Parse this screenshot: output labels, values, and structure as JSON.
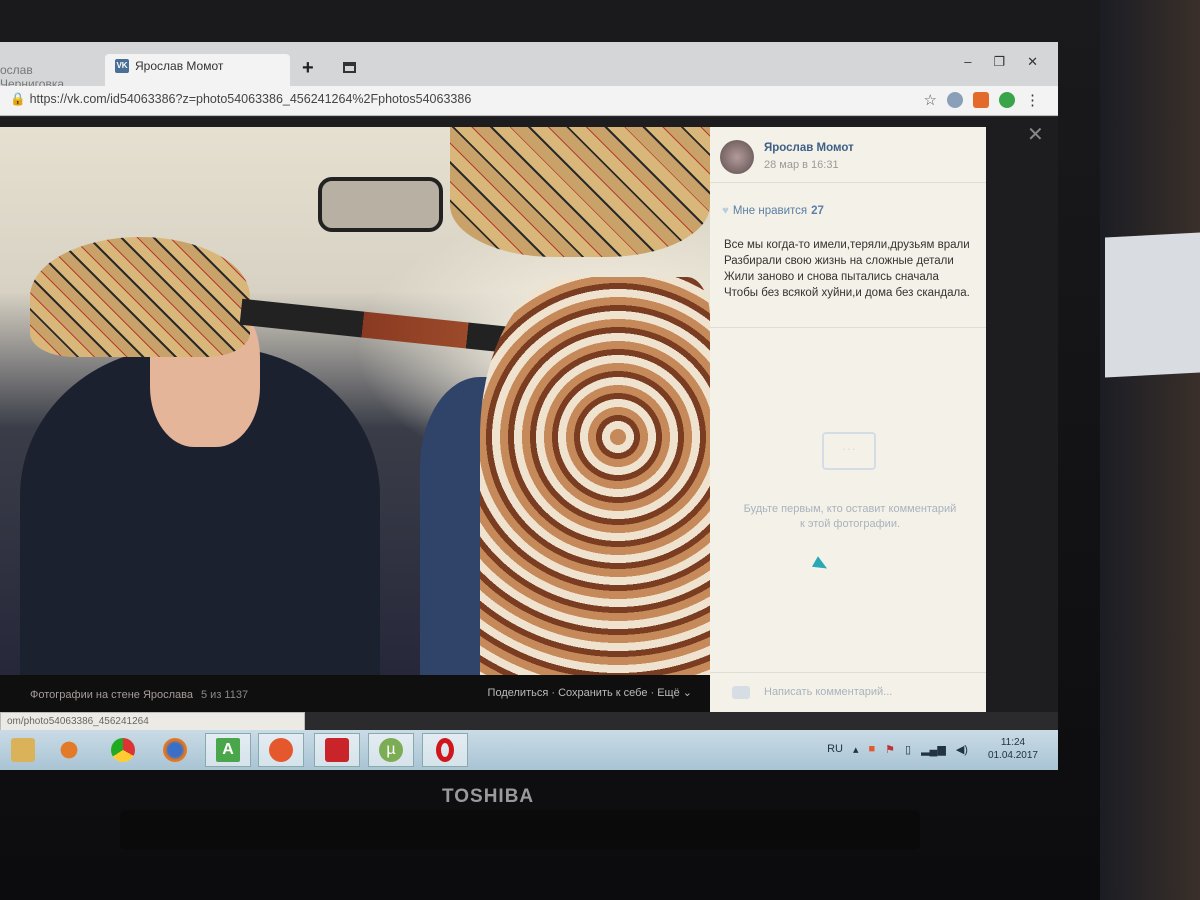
{
  "browser": {
    "tabs": [
      {
        "label": "ослав Черниговка"
      },
      {
        "label": "Ярослав Момот",
        "icon": "vk-icon"
      }
    ],
    "new_tab": "+",
    "window_controls": [
      "‒",
      "❐",
      "✕"
    ],
    "url": "https://vk.com/id54063386?z=photo54063386_456241264%2Fphotos54063386"
  },
  "post": {
    "author": "Ярослав Момот",
    "date": "28 мар в 16:31",
    "like_label": "Мне нравится",
    "like_count": "27",
    "text": "Все мы когда-то имели,теряли,друзьям врали Разбирали свою жизнь на сложные детали Жили заново и снова пытались сначала Чтобы без всякой хуйни,и дома без скандала.",
    "empty_comments": "Будьте первым, кто оставит комментарий к этой фотографии.",
    "comment_placeholder": "Написать комментарий..."
  },
  "caption_bar": {
    "album": "Фотографии на стене Ярослава",
    "counter": "5 из 1137",
    "actions": "Поделиться · Сохранить к себе · Ещё ⌄"
  },
  "status_url": "om/photo54063386_456241264",
  "taskbar": {
    "apps": [
      "explorer",
      "media-player",
      "chrome",
      "firefox",
      "a-app",
      "media-center",
      "video-app",
      "utorrent",
      "opera"
    ],
    "lang": "RU",
    "time": "11:24",
    "date": "01.04.2017"
  },
  "brand": "TOSHIBA",
  "colors": {
    "vk_link": "#3e5f88",
    "panel_bg": "#f4f1e8"
  }
}
